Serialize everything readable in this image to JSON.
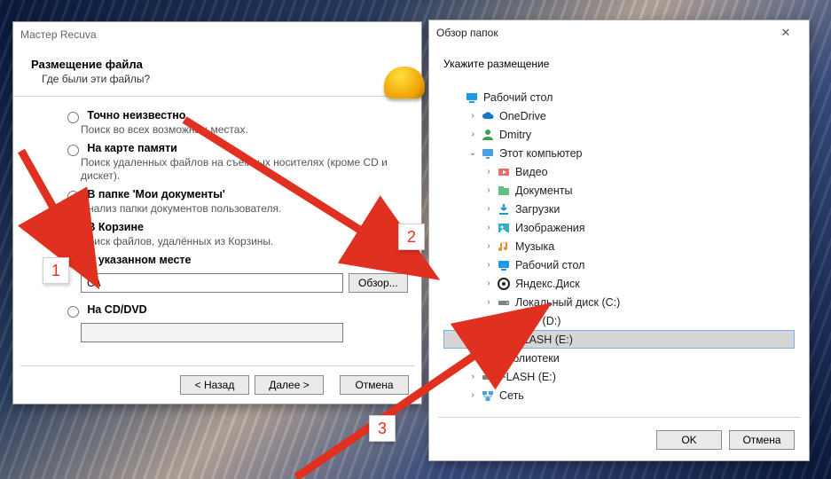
{
  "recuva": {
    "title": "Мастер Recuva",
    "heading": "Размещение файла",
    "sub": "Где были эти файлы?",
    "options": [
      {
        "label": "Точно неизвестно",
        "desc": "Поиск во всех возможных местах."
      },
      {
        "label": "На карте памяти",
        "desc": "Поиск удаленных файлов на съёмных носителях (кроме CD и дискет)."
      },
      {
        "label": "В папке 'Мои документы'",
        "desc": "Анализ папки документов пользователя."
      },
      {
        "label": "В Корзине",
        "desc": "Поиск файлов, удалённых из Корзины."
      },
      {
        "label": "В указанном месте",
        "desc": ""
      },
      {
        "label": "На CD/DVD",
        "desc": ""
      }
    ],
    "path": "C:\\",
    "browse_btn": "Обзор...",
    "back": "< Назад",
    "next": "Далее >",
    "cancel": "Отмена"
  },
  "browse": {
    "title": "Обзор папок",
    "instruction": "Укажите размещение",
    "items": [
      {
        "lvl": 0,
        "icon": "desktop",
        "exp": "",
        "label": "Рабочий стол"
      },
      {
        "lvl": 1,
        "icon": "cloud",
        "exp": ">",
        "label": "OneDrive"
      },
      {
        "lvl": 1,
        "icon": "user",
        "exp": ">",
        "label": "Dmitry"
      },
      {
        "lvl": 1,
        "icon": "pc",
        "exp": "v",
        "label": "Этот компьютер"
      },
      {
        "lvl": 2,
        "icon": "video",
        "exp": ">",
        "label": "Видео"
      },
      {
        "lvl": 2,
        "icon": "docfld",
        "exp": ">",
        "label": "Документы"
      },
      {
        "lvl": 2,
        "icon": "down",
        "exp": ">",
        "label": "Загрузки"
      },
      {
        "lvl": 2,
        "icon": "img",
        "exp": ">",
        "label": "Изображения"
      },
      {
        "lvl": 2,
        "icon": "music",
        "exp": ">",
        "label": "Музыка"
      },
      {
        "lvl": 2,
        "icon": "desktop",
        "exp": ">",
        "label": "Рабочий стол"
      },
      {
        "lvl": 2,
        "icon": "ydisk",
        "exp": ">",
        "label": "Яндекс.Диск"
      },
      {
        "lvl": 2,
        "icon": "drive",
        "exp": ">",
        "label": "Локальный диск (C:)"
      },
      {
        "lvl": 2,
        "icon": "drive",
        "exp": ">",
        "label": "HDD (D:)"
      },
      {
        "lvl": 2,
        "icon": "drive",
        "exp": "",
        "label": "FLASH (E:)",
        "selected": true
      },
      {
        "lvl": 1,
        "icon": "lib",
        "exp": ">",
        "label": "Библиотеки"
      },
      {
        "lvl": 1,
        "icon": "drive",
        "exp": ">",
        "label": "FLASH (E:)"
      },
      {
        "lvl": 1,
        "icon": "net",
        "exp": ">",
        "label": "Сеть"
      }
    ],
    "ok": "OK",
    "cancel": "Отмена"
  },
  "annotations": {
    "n1": "1",
    "n2": "2",
    "n3": "3"
  }
}
